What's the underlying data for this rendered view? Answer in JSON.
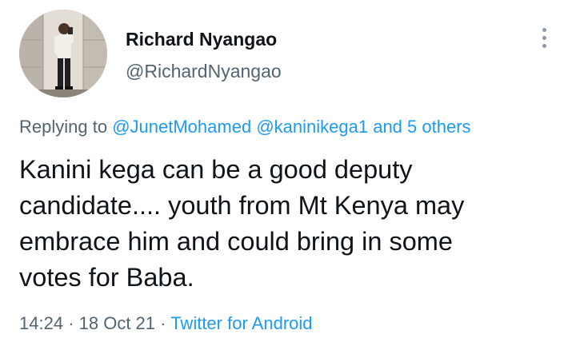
{
  "author": {
    "name": "Richard Nyangao",
    "handle": "@RichardNyangao"
  },
  "more_icon": "more-vertical-icon",
  "replying": {
    "prefix": "Replying to",
    "mention_1": "@JunetMohamed",
    "mention_2": "@kaninikega1",
    "others": "and 5 others"
  },
  "tweet": {
    "lines": [
      "Kanini kega can be a good deputy",
      "candidate.... youth from Mt Kenya may",
      "embrace him and could bring in some",
      "votes for Baba."
    ]
  },
  "meta": {
    "time": "14:24",
    "sep1": "·",
    "date": "18 Oct 21",
    "sep2": "·",
    "source": "Twitter for Android"
  },
  "colors": {
    "text": "#0f1419",
    "secondary": "#536471",
    "link": "#1d9bf0"
  }
}
